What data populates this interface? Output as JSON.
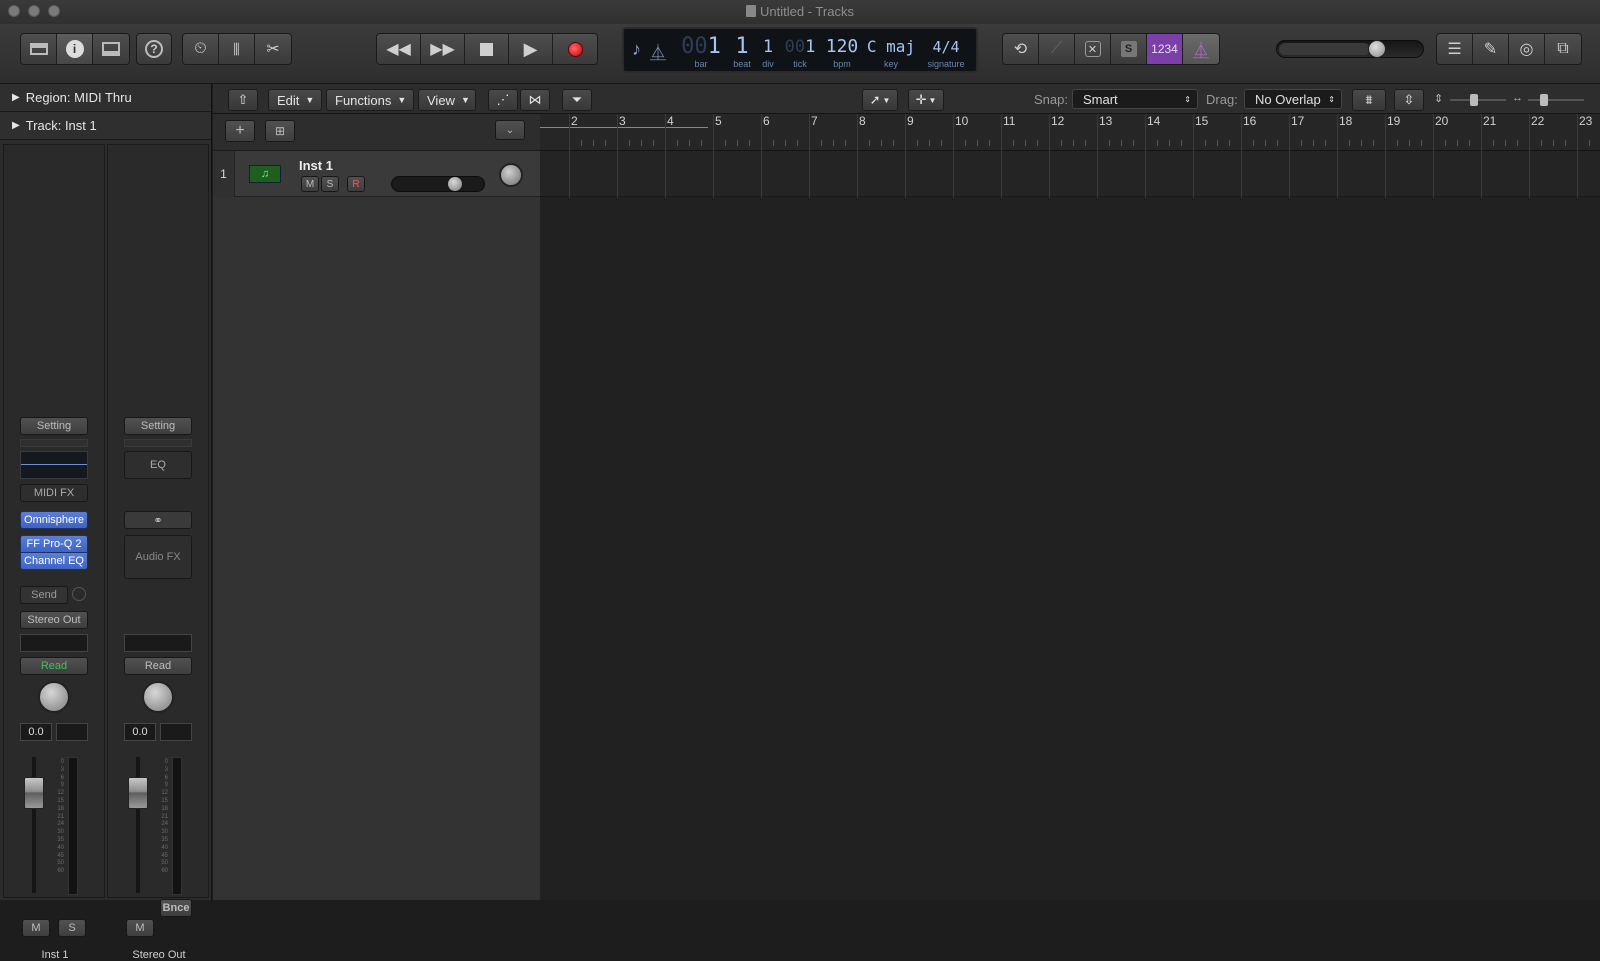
{
  "window": {
    "title": "Untitled - Tracks"
  },
  "control_bar": {
    "left_buttons": [
      {
        "icon": "library-icon"
      },
      {
        "icon": "inspector-icon"
      },
      {
        "icon": "toolbar-icon"
      }
    ],
    "quick_help_icon": "question-icon",
    "smart_controls_icon": "smart-controls-icon",
    "mixer_icon": "mixer-icon",
    "editors_icon": "scissors-icon",
    "transport": [
      "rewind-icon",
      "fast-forward-icon",
      "stop-icon",
      "play-icon",
      "record-icon"
    ],
    "lcd": {
      "bar": {
        "dim": "00",
        "value": "1",
        "label": "bar"
      },
      "beat": {
        "value": "1",
        "label": "beat"
      },
      "div": {
        "value": "1",
        "label": "div"
      },
      "tick": {
        "dim": "00",
        "value": "1",
        "label": "tick"
      },
      "bpm": {
        "value": "120",
        "label": "bpm"
      },
      "key": {
        "value": "C maj",
        "label": "key"
      },
      "signature": {
        "value": "4/4",
        "label": "signature"
      }
    },
    "right_mode_buttons": [
      "cycle-icon",
      "tuner-icon",
      "replace-icon",
      "S",
      "1234",
      "metronome-icon"
    ],
    "count_in_label": "1234",
    "solo_label": "S",
    "master_volume": 0.7,
    "right_buttons": [
      "list-icon",
      "notepad-icon",
      "loop-browser-icon",
      "media-browser-icon"
    ],
    "accent_purple": "#7b3fa8"
  },
  "inspector": {
    "region_label": "Region: MIDI Thru",
    "track_label": "Track: Inst 1",
    "strip1": {
      "setting": "Setting",
      "midi_fx": "MIDI FX",
      "instrument": "Omnisphere",
      "audio_fx": [
        "FF Pro-Q 2",
        "Channel EQ"
      ],
      "send": "Send",
      "output": "Stereo Out",
      "automation": "Read",
      "pan_value": "0.0",
      "mute": "M",
      "solo": "S",
      "name": "Inst 1"
    },
    "strip2": {
      "setting": "Setting",
      "eq": "EQ",
      "audio_fx": "Audio FX",
      "automation": "Read",
      "pan_value": "0.0",
      "bounce": "Bnce",
      "mute": "M",
      "name": "Stereo Out"
    },
    "meter_scale": [
      "0",
      "3",
      "6",
      "9",
      "12",
      "15",
      "18",
      "21",
      "24",
      "30",
      "35",
      "40",
      "45",
      "50",
      "60"
    ]
  },
  "tracks_header": {
    "menus": [
      "Edit",
      "Functions",
      "View"
    ],
    "snap_label": "Snap:",
    "snap_value": "Smart",
    "drag_label": "Drag:",
    "drag_value": "No Overlap"
  },
  "tracks": [
    {
      "number": "1",
      "name": "Inst 1",
      "mute": "M",
      "solo": "S",
      "record": "R",
      "volume": 0.72
    }
  ],
  "ruler": {
    "bars": [
      "2",
      "3",
      "4",
      "5",
      "6",
      "7",
      "8",
      "9",
      "10",
      "11",
      "12",
      "13",
      "14",
      "15",
      "16",
      "17",
      "18",
      "19",
      "20",
      "21",
      "22",
      "23"
    ]
  }
}
